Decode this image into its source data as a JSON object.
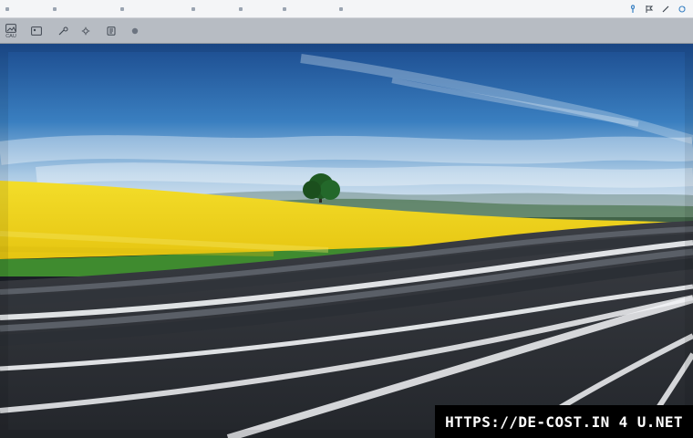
{
  "topbar": {
    "left_items": [
      "",
      "",
      "",
      "",
      "",
      "",
      ""
    ],
    "right_icons": [
      "pin-icon",
      "flag-icon",
      "pen-icon",
      "refresh-icon"
    ]
  },
  "toolbar": {
    "items": [
      {
        "icon": "image-icon",
        "label": "CAU"
      },
      {
        "icon": "photo-icon",
        "label": ""
      },
      {
        "icon": "tools-icon",
        "label": ""
      },
      {
        "icon": "settings-icon",
        "label": ""
      },
      {
        "icon": "info-icon",
        "label": ""
      },
      {
        "icon": "circle-icon",
        "label": ""
      }
    ]
  },
  "viewer": {
    "scene": "road-field-sky",
    "watermark": "HTTPS://DE-COST.IN 4 U.NET"
  },
  "colors": {
    "sky_top": "#1d4f93",
    "sky_mid": "#3b7fc0",
    "field": "#f0d31c",
    "road": "#2c2f35"
  }
}
